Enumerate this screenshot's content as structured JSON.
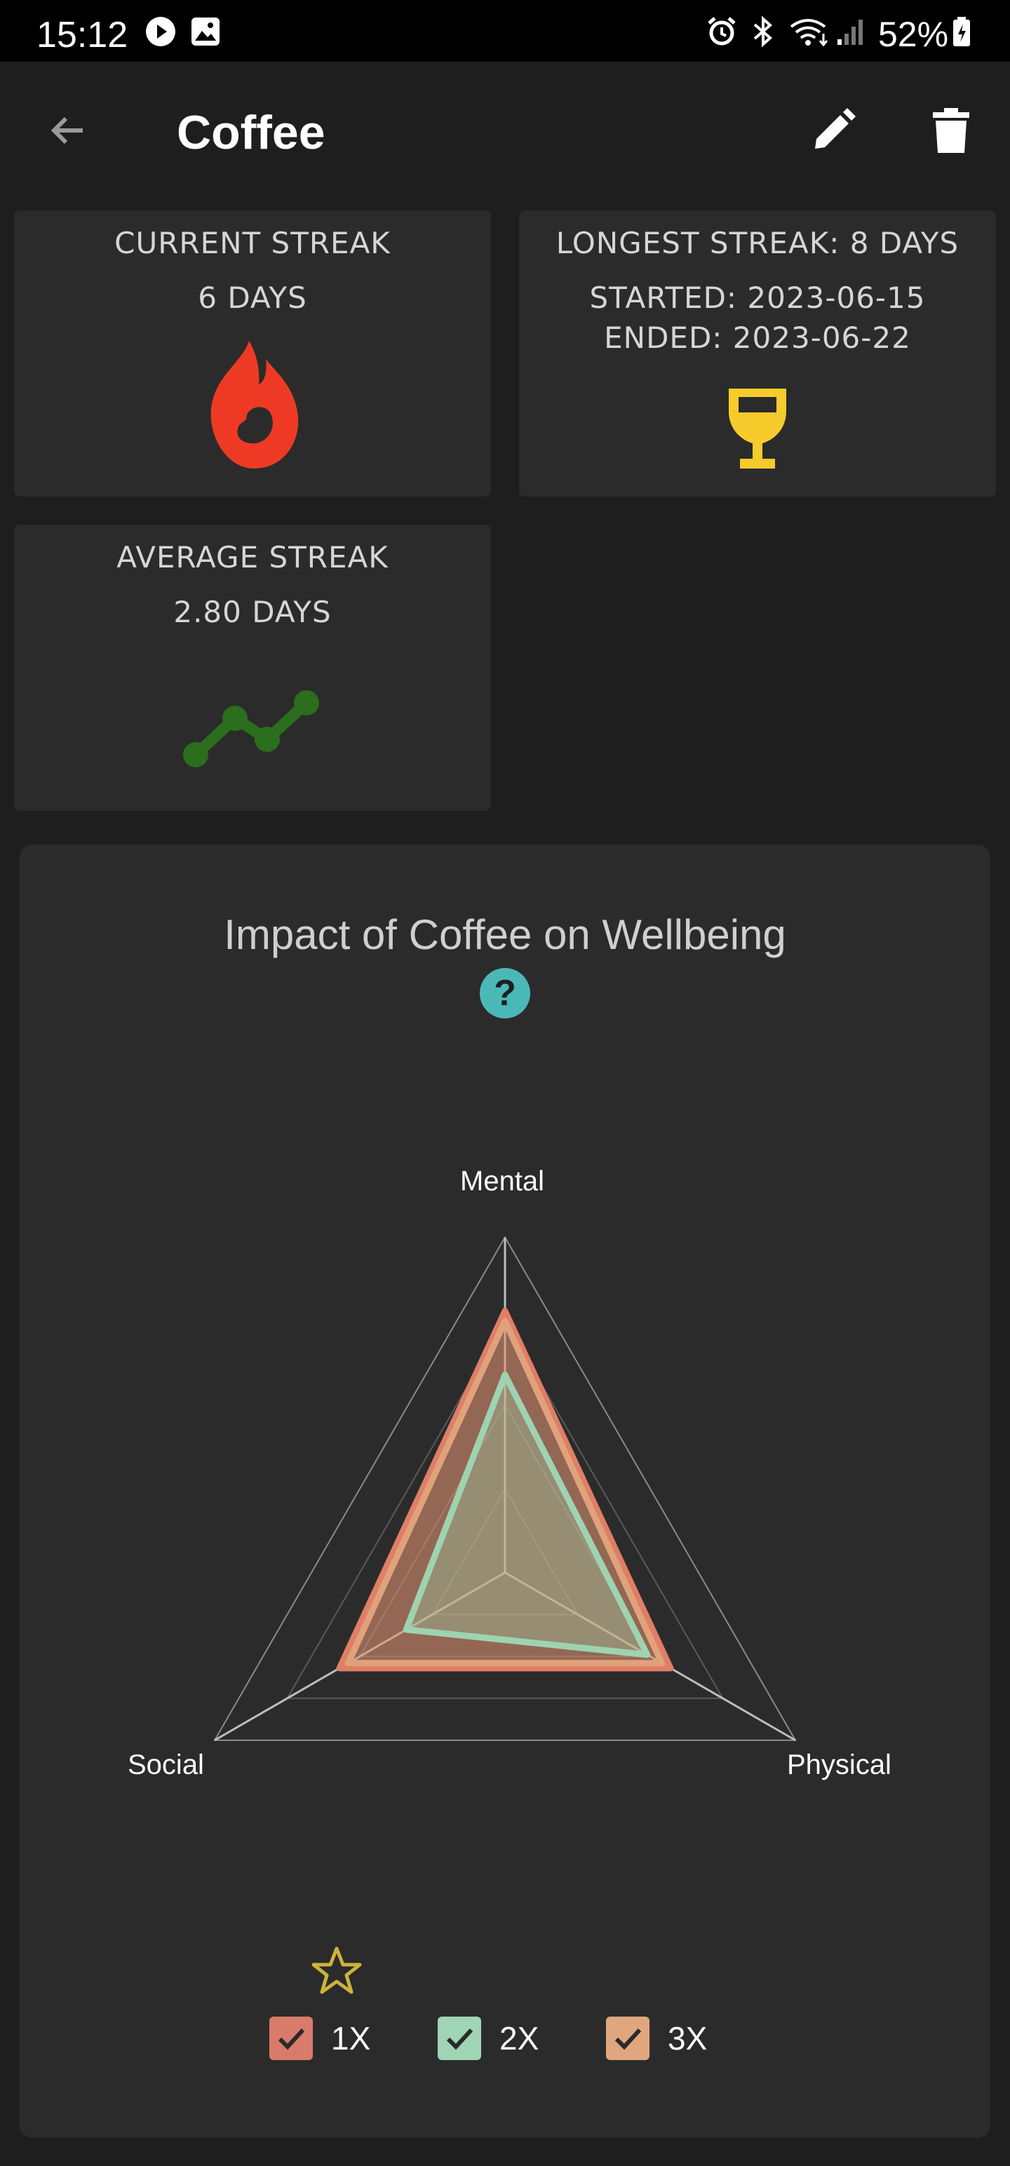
{
  "status_bar": {
    "time": "15:12",
    "battery": "52%",
    "icons": [
      "play-icon",
      "image-icon",
      "alarm-icon",
      "bluetooth-icon",
      "wifi-icon",
      "signal-icon",
      "battery-icon"
    ]
  },
  "app_bar": {
    "title": "Coffee",
    "back_icon": "arrow-left-icon",
    "edit_icon": "pencil-icon",
    "delete_icon": "trash-icon"
  },
  "stats": {
    "current": {
      "title": "CURRENT STREAK",
      "value": "6 DAYS",
      "icon": "flame-icon",
      "color": "#ee3a24"
    },
    "longest": {
      "title": "LONGEST STREAK: 8 DAYS",
      "started": "STARTED: 2023-06-15",
      "ended": "ENDED: 2023-06-22",
      "icon": "trophy-icon",
      "color": "#f6cb2c"
    },
    "average": {
      "title": "AVERAGE STREAK",
      "value": "2.80 DAYS",
      "icon": "trend-icon",
      "color": "#2b6e1d"
    }
  },
  "chart_data": {
    "type": "radar",
    "title": "Impact of Coffee on Wellbeing",
    "axes": [
      "Mental",
      "Physical",
      "Social"
    ],
    "rmax": 1.0,
    "grid_levels": 4,
    "series": [
      {
        "name": "1X",
        "values": [
          0.78,
          0.57,
          0.57
        ],
        "color": "#e07e66"
      },
      {
        "name": "3X",
        "values": [
          0.75,
          0.54,
          0.54
        ],
        "color": "#e0a27a"
      },
      {
        "name": "2X",
        "values": [
          0.59,
          0.49,
          0.34
        ],
        "color": "#9ed3b0"
      }
    ]
  },
  "legend": {
    "star_icon": "star-icon",
    "items": [
      {
        "label": "1X",
        "color": "#d97b6a"
      },
      {
        "label": "2X",
        "color": "#9fd4b5"
      },
      {
        "label": "3X",
        "color": "#e0a67e"
      }
    ]
  }
}
